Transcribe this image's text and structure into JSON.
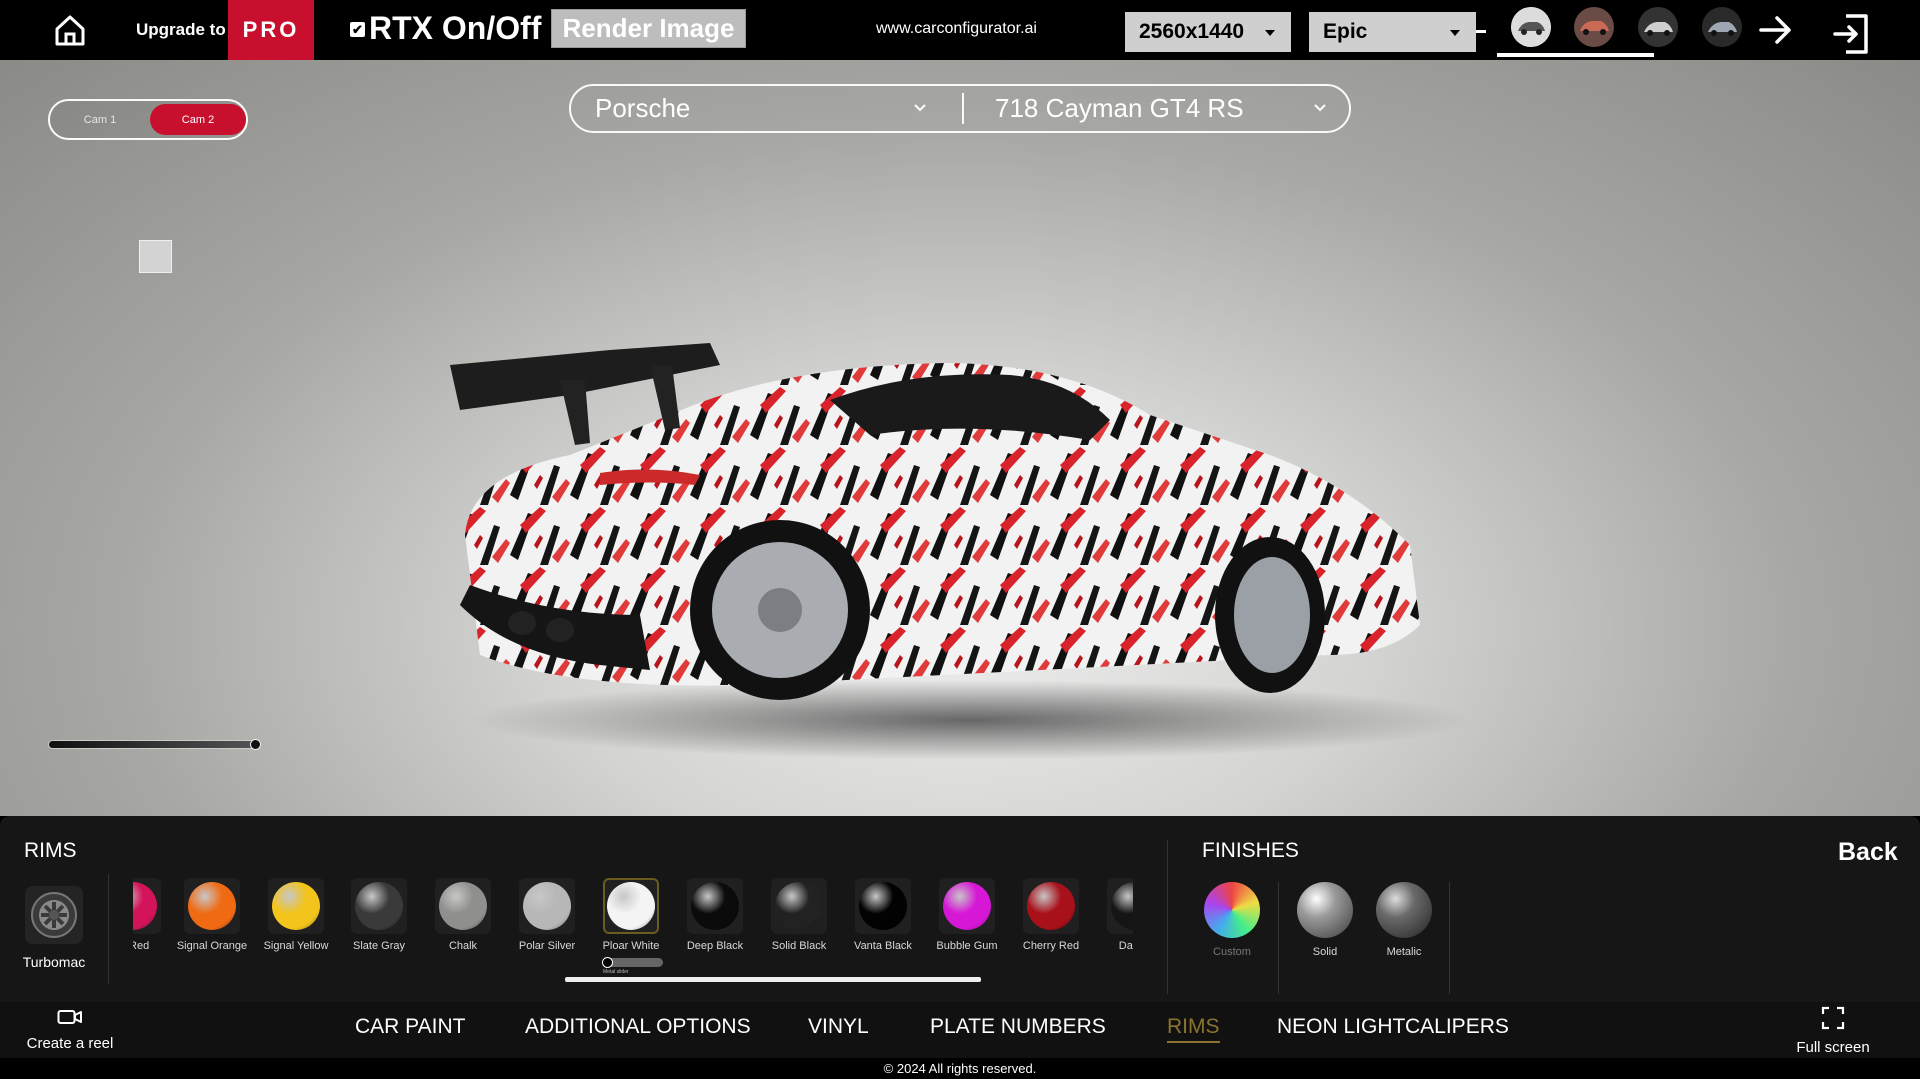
{
  "topbar": {
    "upgrade_label": "Upgrade to",
    "pro_label": "PRO",
    "rtx_label": "RTX On/Off",
    "rtx_checked": true,
    "render_label": "Render Image",
    "site_url": "www.carconfigurator.ai",
    "resolution": "2560x1440",
    "quality": "Epic",
    "icons": [
      "home-icon",
      "checkbox-checked-icon",
      "caret-down-icon",
      "car-thumbnail",
      "arrow-right-icon",
      "exit-icon"
    ]
  },
  "viewport": {
    "cam_options": [
      "Cam 1",
      "Cam 2"
    ],
    "active_cam": "Cam 2",
    "make": "Porsche",
    "model": "718 Cayman GT4 RS",
    "accent_color": "#c8102e"
  },
  "panel": {
    "rims_title": "RIMS",
    "finishes_title": "FINISHES",
    "back_label": "Back",
    "rim": {
      "label": "Turbomac",
      "icon": "rim-icon"
    },
    "swatches": [
      {
        "label": "... Red",
        "color": "#d4145a"
      },
      {
        "label": "Signal Orange",
        "color": "#f06a14"
      },
      {
        "label": "Signal Yellow",
        "color": "#f2c41c"
      },
      {
        "label": "Slate Gray",
        "color": "#3a3a3a"
      },
      {
        "label": "Chalk",
        "color": "#8f8f8d"
      },
      {
        "label": "Polar Silver",
        "color": "#b7b7b7"
      },
      {
        "label": "Ploar White",
        "color": "#f4f4f4"
      },
      {
        "label": "Deep Black",
        "color": "#0b0b0b"
      },
      {
        "label": "Solid Black",
        "color": "#222222"
      },
      {
        "label": "Vanta Black",
        "color": "#020202"
      },
      {
        "label": "Bubble Gum",
        "color": "#d617d6"
      },
      {
        "label": "Cherry Red",
        "color": "#a8101a"
      },
      {
        "label": "Dark...",
        "color": "#151515"
      }
    ],
    "selected_swatch": "Ploar White",
    "metal_slider_label": "Metal slider",
    "finishes": [
      {
        "label": "Custom",
        "dim": true
      },
      {
        "label": "Solid",
        "dim": false
      },
      {
        "label": "Metalic",
        "dim": false
      }
    ]
  },
  "navbar": {
    "create_reel": "Create a reel",
    "tabs": [
      "CAR PAINT",
      "ADDITIONAL OPTIONS",
      "VINYL",
      "PLATE NUMBERS",
      "RIMS",
      "NEON LIGHT",
      "CALIPERS"
    ],
    "active_tab": "RIMS",
    "fullscreen": "Full screen",
    "active_color": "#8a7430"
  },
  "footer": {
    "copyright": "© 2024 All rights reserved."
  }
}
